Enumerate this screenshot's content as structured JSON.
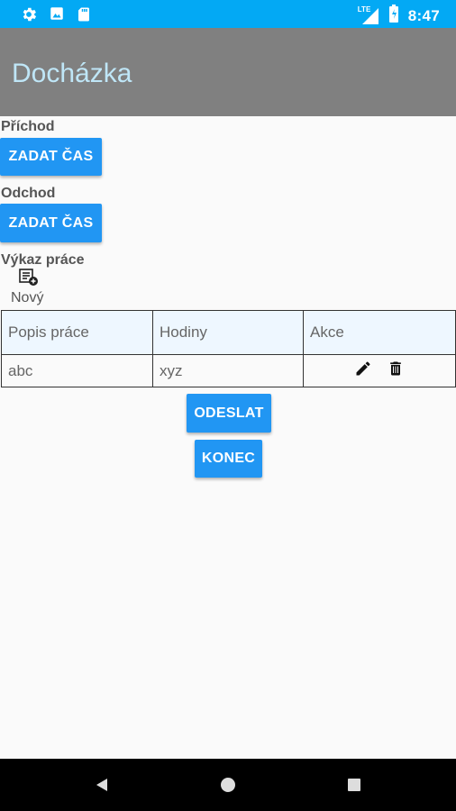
{
  "status_bar": {
    "time": "8:47",
    "network_label": "LTE",
    "icons": [
      "gear-icon",
      "photo-icon",
      "sd-card-icon",
      "signal-icon",
      "battery-icon"
    ]
  },
  "app_bar": {
    "title": "Docházka"
  },
  "arrival": {
    "label": "Příchod",
    "button": "ZADAT ČAS"
  },
  "departure": {
    "label": "Odchod",
    "button": "ZADAT ČAS"
  },
  "report": {
    "label": "Výkaz práce",
    "new_label": "Nový"
  },
  "table": {
    "headers": [
      "Popis práce",
      "Hodiny",
      "Akce"
    ],
    "rows": [
      {
        "description": "abc",
        "hours": "xyz"
      }
    ]
  },
  "actions": {
    "send_label": "ODESLAT",
    "end_label": "KONEC"
  },
  "colors": {
    "status_bar": "#03a9f4",
    "app_bar": "#808080",
    "title": "#bfe6f7",
    "button": "#2196f3",
    "table_header": "#eef7ff"
  }
}
